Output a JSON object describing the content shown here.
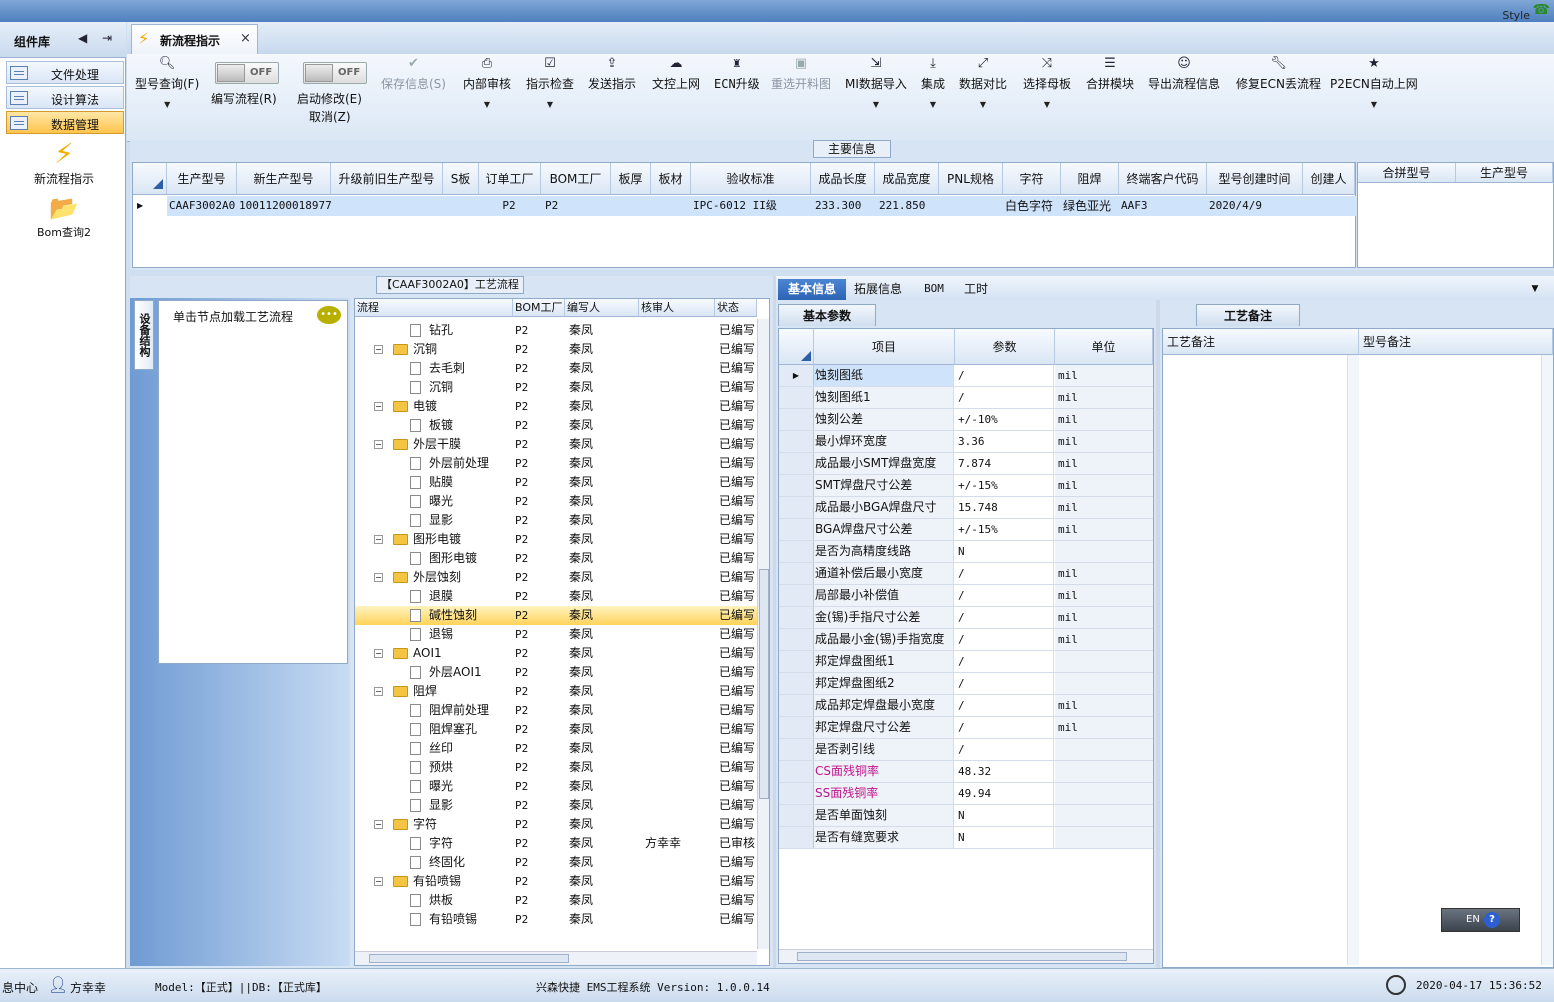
{
  "topbar": {
    "style_label": "Style"
  },
  "sidebar": {
    "title": "组件库",
    "tabs": [
      {
        "label": "文件处理",
        "active": false
      },
      {
        "label": "设计算法",
        "active": false
      },
      {
        "label": "数据管理",
        "active": true
      }
    ],
    "items": [
      {
        "label": "新流程指示",
        "icon": "lightning-icon"
      },
      {
        "label": "Bom查询2",
        "icon": "folder-open-icon"
      }
    ]
  },
  "doc_tab": {
    "label": "新流程指示",
    "close": "×"
  },
  "toolbar": {
    "model_query": "型号查询(F)",
    "toggle_off": "OFF",
    "edit_flow": "编写流程(R)",
    "start_modify": "启动修改(E)",
    "cancel": "取消(Z)",
    "save_info": "保存信息(S)",
    "internal_review": "内部审核",
    "instruction_check": "指示检查",
    "send_instruction": "发送指示",
    "ctrl_upload": "文控上网",
    "ecn_upgrade": "ECN升级",
    "reselect_cutting": "重选开料图",
    "mi_import": "MI数据导入",
    "integrate": "集成",
    "data_compare": "数据对比",
    "select_master": "选择母板",
    "merge_module": "合拼模块",
    "export_flow": "导出流程信息",
    "repair_ecn": "修复ECN丢流程",
    "p2ecn_upload": "P2ECN自动上网"
  },
  "main_info": {
    "title": "主要信息",
    "columns": [
      "生产型号",
      "新生产型号",
      "升级前旧生产型号",
      "S板",
      "订单工厂",
      "BOM工厂",
      "板厚",
      "板材",
      "验收标准",
      "成品长度",
      "成品宽度",
      "PNL规格",
      "字符",
      "阻焊",
      "终端客户代码",
      "型号创建时间",
      "创建人"
    ],
    "row": {
      "生产型号": "CAAF3002A0",
      "新生产型号": "10011200018977",
      "订单工厂": "P2",
      "BOM工厂": "P2",
      "验收标准": "IPC-6012 II级",
      "成品长度": "233.300",
      "成品宽度": "221.850",
      "字符": "白色字符",
      "阻焊": "绿色亚光",
      "终端客户代码": "AAF3",
      "型号创建时间": "2020/4/9"
    },
    "right_columns": [
      "合拼型号",
      "生产型号"
    ]
  },
  "workflow": {
    "title": "【CAAF3002A0】工艺流程",
    "side_tab": "设备结构",
    "node_hint": "单击节点加载工艺流程",
    "columns": [
      "流程",
      "BOM工厂",
      "编写人",
      "核审人",
      "状态"
    ],
    "rows": [
      {
        "level": 2,
        "name": "钻孔",
        "factory": "P2",
        "writer": "秦凤",
        "reviewer": "",
        "status": "已编写"
      },
      {
        "level": 1,
        "name": "沉铜",
        "factory": "P2",
        "writer": "秦凤",
        "reviewer": "",
        "status": "已编写"
      },
      {
        "level": 2,
        "name": "去毛刺",
        "factory": "P2",
        "writer": "秦凤",
        "reviewer": "",
        "status": "已编写"
      },
      {
        "level": 2,
        "name": "沉铜",
        "factory": "P2",
        "writer": "秦凤",
        "reviewer": "",
        "status": "已编写"
      },
      {
        "level": 1,
        "name": "电镀",
        "factory": "P2",
        "writer": "秦凤",
        "reviewer": "",
        "status": "已编写"
      },
      {
        "level": 2,
        "name": "板镀",
        "factory": "P2",
        "writer": "秦凤",
        "reviewer": "",
        "status": "已编写"
      },
      {
        "level": 1,
        "name": "外层干膜",
        "factory": "P2",
        "writer": "秦凤",
        "reviewer": "",
        "status": "已编写"
      },
      {
        "level": 2,
        "name": "外层前处理",
        "factory": "P2",
        "writer": "秦凤",
        "reviewer": "",
        "status": "已编写"
      },
      {
        "level": 2,
        "name": "贴膜",
        "factory": "P2",
        "writer": "秦凤",
        "reviewer": "",
        "status": "已编写"
      },
      {
        "level": 2,
        "name": "曝光",
        "factory": "P2",
        "writer": "秦凤",
        "reviewer": "",
        "status": "已编写"
      },
      {
        "level": 2,
        "name": "显影",
        "factory": "P2",
        "writer": "秦凤",
        "reviewer": "",
        "status": "已编写"
      },
      {
        "level": 1,
        "name": "图形电镀",
        "factory": "P2",
        "writer": "秦凤",
        "reviewer": "",
        "status": "已编写"
      },
      {
        "level": 2,
        "name": "图形电镀",
        "factory": "P2",
        "writer": "秦凤",
        "reviewer": "",
        "status": "已编写"
      },
      {
        "level": 1,
        "name": "外层蚀刻",
        "factory": "P2",
        "writer": "秦凤",
        "reviewer": "",
        "status": "已编写"
      },
      {
        "level": 2,
        "name": "退膜",
        "factory": "P2",
        "writer": "秦凤",
        "reviewer": "",
        "status": "已编写"
      },
      {
        "level": 2,
        "name": "碱性蚀刻",
        "factory": "P2",
        "writer": "秦凤",
        "reviewer": "",
        "status": "已编写",
        "selected": true
      },
      {
        "level": 2,
        "name": "退锡",
        "factory": "P2",
        "writer": "秦凤",
        "reviewer": "",
        "status": "已编写"
      },
      {
        "level": 1,
        "name": "AOI1",
        "factory": "P2",
        "writer": "秦凤",
        "reviewer": "",
        "status": "已编写"
      },
      {
        "level": 2,
        "name": "外层AOI1",
        "factory": "P2",
        "writer": "秦凤",
        "reviewer": "",
        "status": "已编写"
      },
      {
        "level": 1,
        "name": "阻焊",
        "factory": "P2",
        "writer": "秦凤",
        "reviewer": "",
        "status": "已编写"
      },
      {
        "level": 2,
        "name": "阻焊前处理",
        "factory": "P2",
        "writer": "秦凤",
        "reviewer": "",
        "status": "已编写"
      },
      {
        "level": 2,
        "name": "阻焊塞孔",
        "factory": "P2",
        "writer": "秦凤",
        "reviewer": "",
        "status": "已编写"
      },
      {
        "level": 2,
        "name": "丝印",
        "factory": "P2",
        "writer": "秦凤",
        "reviewer": "",
        "status": "已编写"
      },
      {
        "level": 2,
        "name": "预烘",
        "factory": "P2",
        "writer": "秦凤",
        "reviewer": "",
        "status": "已编写"
      },
      {
        "level": 2,
        "name": "曝光",
        "factory": "P2",
        "writer": "秦凤",
        "reviewer": "",
        "status": "已编写"
      },
      {
        "level": 2,
        "name": "显影",
        "factory": "P2",
        "writer": "秦凤",
        "reviewer": "",
        "status": "已编写"
      },
      {
        "level": 1,
        "name": "字符",
        "factory": "P2",
        "writer": "秦凤",
        "reviewer": "",
        "status": "已编写"
      },
      {
        "level": 2,
        "name": "字符",
        "factory": "P2",
        "writer": "秦凤",
        "reviewer": "方幸幸",
        "status": "已审核"
      },
      {
        "level": 2,
        "name": "终固化",
        "factory": "P2",
        "writer": "秦凤",
        "reviewer": "",
        "status": "已编写"
      },
      {
        "level": 1,
        "name": "有铅喷锡",
        "factory": "P2",
        "writer": "秦凤",
        "reviewer": "",
        "status": "已编写"
      },
      {
        "level": 2,
        "name": "烘板",
        "factory": "P2",
        "writer": "秦凤",
        "reviewer": "",
        "status": "已编写"
      },
      {
        "level": 2,
        "name": "有铅喷锡",
        "factory": "P2",
        "writer": "秦凤",
        "reviewer": "",
        "status": "已编写"
      }
    ]
  },
  "detail_tabs": [
    "基本信息",
    "拓展信息",
    "BOM",
    "工时"
  ],
  "basic_params": {
    "title": "基本参数",
    "columns": [
      "项目",
      "参数",
      "单位"
    ],
    "rows": [
      {
        "item": "蚀刻图纸",
        "value": "/",
        "unit": "mil"
      },
      {
        "item": "蚀刻图纸1",
        "value": "/",
        "unit": "mil"
      },
      {
        "item": "蚀刻公差",
        "value": "+/-10%",
        "unit": "mil"
      },
      {
        "item": "最小焊环宽度",
        "value": "3.36",
        "unit": "mil"
      },
      {
        "item": "成品最小SMT焊盘宽度",
        "value": "7.874",
        "unit": "mil"
      },
      {
        "item": "SMT焊盘尺寸公差",
        "value": "+/-15%",
        "unit": "mil"
      },
      {
        "item": "成品最小BGA焊盘尺寸",
        "value": "15.748",
        "unit": "mil"
      },
      {
        "item": "BGA焊盘尺寸公差",
        "value": "+/-15%",
        "unit": "mil"
      },
      {
        "item": "是否为高精度线路",
        "value": "N",
        "unit": ""
      },
      {
        "item": "通道补偿后最小宽度",
        "value": "/",
        "unit": "mil"
      },
      {
        "item": "局部最小补偿值",
        "value": "/",
        "unit": "mil"
      },
      {
        "item": "金(锡)手指尺寸公差",
        "value": "/",
        "unit": "mil"
      },
      {
        "item": "成品最小金(锡)手指宽度",
        "value": "/",
        "unit": "mil"
      },
      {
        "item": "邦定焊盘图纸1",
        "value": "/",
        "unit": ""
      },
      {
        "item": "邦定焊盘图纸2",
        "value": "/",
        "unit": ""
      },
      {
        "item": "成品邦定焊盘最小宽度",
        "value": "/",
        "unit": "mil"
      },
      {
        "item": "邦定焊盘尺寸公差",
        "value": "/",
        "unit": "mil"
      },
      {
        "item": "是否剥引线",
        "value": "/",
        "unit": ""
      },
      {
        "item": "CS面残铜率",
        "value": "48.32",
        "unit": "",
        "pink": true
      },
      {
        "item": "SS面残铜率",
        "value": "49.94",
        "unit": "",
        "pink": true
      },
      {
        "item": "是否单面蚀刻",
        "value": "N",
        "unit": ""
      },
      {
        "item": "是否有缝宽要求",
        "value": "N",
        "unit": ""
      }
    ]
  },
  "notes": {
    "title": "工艺备注",
    "columns": [
      "工艺备注",
      "型号备注"
    ]
  },
  "ime": {
    "label": "EN"
  },
  "status_bar": {
    "info_center": "息中心",
    "user": "方幸幸",
    "model": "Model:【正式】||DB:【正式库】",
    "system": "兴森快捷 EMS工程系统 Version: 1.0.0.14",
    "datetime": "2020-04-17 15:36:52"
  }
}
